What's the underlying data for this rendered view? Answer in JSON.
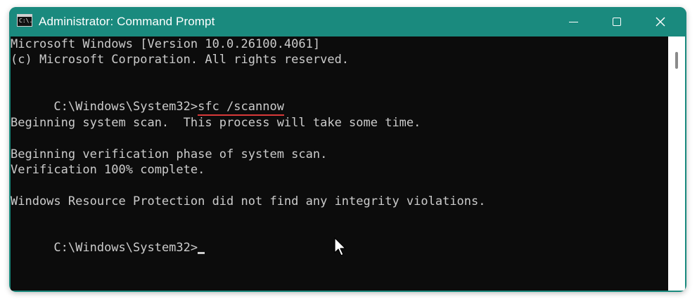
{
  "window": {
    "title": "Administrator: Command Prompt",
    "app_icon_text": "C:\\."
  },
  "console": {
    "line_1": "Microsoft Windows [Version 10.0.26100.4061]",
    "line_2": "(c) Microsoft Corporation. All rights reserved.",
    "prompt_1": "C:\\Windows\\System32>",
    "command_1": "sfc /scannow",
    "line_3": "Beginning system scan.  This process will take some time.",
    "line_4": "Beginning verification phase of system scan.",
    "line_5": "Verification 100% complete.",
    "line_6": "Windows Resource Protection did not find any integrity violations.",
    "prompt_2": "C:\\Windows\\System32>"
  },
  "icons": {
    "app": "command-prompt-icon",
    "minimize": "minimize-icon",
    "maximize": "maximize-icon",
    "close": "close-icon",
    "pointer": "mouse-pointer-icon"
  },
  "colors": {
    "titlebar": "#1a8a7e",
    "terminal_bg": "#0c0c0c",
    "terminal_text": "#cccccc",
    "highlight_underline": "#d93a3a"
  }
}
